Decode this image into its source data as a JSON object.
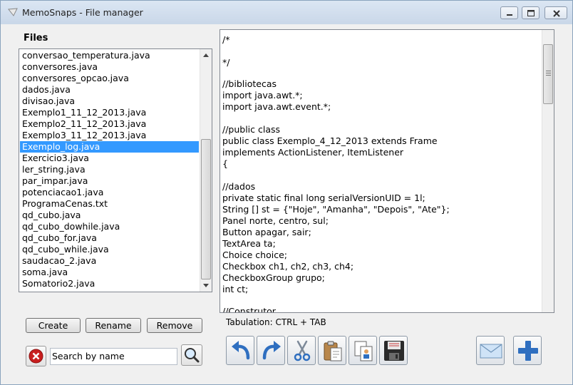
{
  "window": {
    "title": "MemoSnaps - File manager",
    "controls": [
      "minimize",
      "maximize",
      "close"
    ]
  },
  "files": {
    "label": "Files",
    "selected_index": 8,
    "items": [
      "conversao_temperatura.java",
      "conversores.java",
      "conversores_opcao.java",
      "dados.java",
      "divisao.java",
      "Exemplo1_11_12_2013.java",
      "Exemplo2_11_12_2013.java",
      "Exemplo3_11_12_2013.java",
      "Exemplo_log.java",
      "Exercicio3.java",
      "ler_string.java",
      "par_impar.java",
      "potenciacao1.java",
      "ProgramaCenas.txt",
      "qd_cubo.java",
      "qd_cubo_dowhile.java",
      "qd_cubo_for.java",
      "qd_cubo_while.java",
      "saudacao_2.java",
      "soma.java",
      "Somatorio2.java"
    ]
  },
  "buttons": {
    "create": "Create",
    "rename": "Rename",
    "remove": "Remove"
  },
  "search": {
    "value": "Search by name",
    "clear_icon": "red-x-icon",
    "search_icon": "magnifier-icon"
  },
  "editor": {
    "lines": [
      "/*",
      "",
      "*/",
      "",
      "//bibliotecas",
      "import java.awt.*;",
      "import java.awt.event.*;",
      "",
      "//public class",
      "public class Exemplo_4_12_2013 extends Frame",
      "implements ActionListener, ItemListener",
      "{",
      "",
      "//dados",
      "private static final long serialVersionUID = 1l;",
      "String [] st = {\"Hoje\", \"Amanha\", \"Depois\", \"Ate\"};",
      "Panel norte, centro, sul;",
      "Button apagar, sair;",
      "TextArea ta;",
      "Choice choice;",
      "Checkbox ch1, ch2, ch3, ch4;",
      "CheckboxGroup grupo;",
      "int ct;",
      "",
      "//Construtor"
    ],
    "tab_hint": "Tabulation: CTRL + TAB"
  },
  "toolbar": {
    "icons": [
      "undo-icon",
      "redo-icon",
      "scissors-icon",
      "paste-icon",
      "copy-icon",
      "save-icon",
      "envelope-icon",
      "plus-icon"
    ]
  },
  "colors": {
    "selection": "#3399ff",
    "icon_blue": "#2f6fc0",
    "clear_red": "#c81e1e"
  }
}
